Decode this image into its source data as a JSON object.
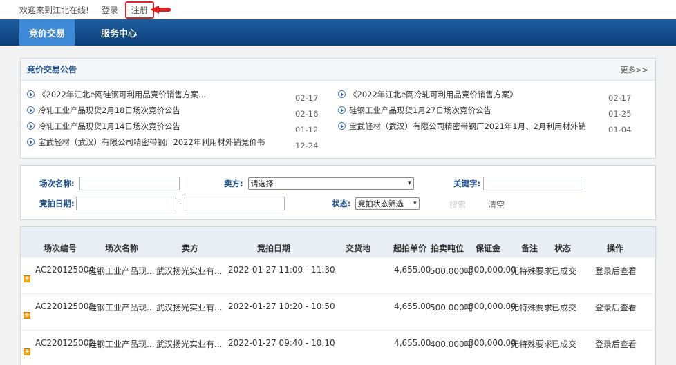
{
  "topbar": {
    "welcome": "欢迎来到江北在线!",
    "login": "登录",
    "register": "注册"
  },
  "nav": {
    "items": [
      {
        "label": "竞价交易",
        "active": true
      },
      {
        "label": "服务中心",
        "active": false
      }
    ]
  },
  "notice": {
    "title": "竞价交易公告",
    "more": "更多>>",
    "left": [
      {
        "title": "《2022年江北e网硅钢可利用品竞价销售方案...",
        "date": "02-17"
      },
      {
        "title": "冷轧工业产品现货2月18日场次竞价公告",
        "date": "02-16"
      },
      {
        "title": "冷轧工业产品现货1月14日场次竞价公告",
        "date": "01-12"
      },
      {
        "title": "宝武轻材（武汉）有限公司精密带钢厂2022年利用材外销竞价书",
        "date": "12-24"
      }
    ],
    "right": [
      {
        "title": "《2022年江北e网冷轧可利用品竞价销售方案》",
        "date": "02-17"
      },
      {
        "title": "硅钢工业产品现货1月27日场次竞价公告",
        "date": "01-25"
      },
      {
        "title": "宝武轻材（武汉）有限公司精密带钢厂2021年1月、2月利用材外销",
        "date": "01-04"
      }
    ]
  },
  "filter": {
    "session_name_label": "场次名称:",
    "seller_label": "卖方:",
    "seller_value": "请选择",
    "keyword_label": "关键字:",
    "date_label": "竞拍日期:",
    "date_separator": "-",
    "status_label": "状态:",
    "status_value": "竞拍状态筛选",
    "search": "搜索",
    "clear": "清空"
  },
  "table": {
    "headers": [
      "场次编号",
      "场次名称",
      "卖方",
      "竞拍日期",
      "交货地",
      "起拍单价",
      "拍卖吨位",
      "保证金",
      "备注",
      "状态",
      "操作"
    ],
    "rows": [
      {
        "id": "AC220125004",
        "name": "硅钢工业产品现...",
        "seller": "武汉扬光实业有...",
        "date": "2022-01-27 11:00 - 11:30",
        "place": "",
        "price": "4,655.00",
        "tonnage": "500.000吨",
        "deposit": "300,000.00",
        "remark": "无特殊要求",
        "status": "已成交",
        "action": "登录后查看"
      },
      {
        "id": "AC220125003",
        "name": "硅钢工业产品现...",
        "seller": "武汉扬光实业有...",
        "date": "2022-01-27 10:20 - 10:50",
        "place": "",
        "price": "4,655.00",
        "tonnage": "500.000吨",
        "deposit": "300,000.00",
        "remark": "无特殊要求",
        "status": "已成交",
        "action": "登录后查看"
      },
      {
        "id": "AC220125002",
        "name": "硅钢工业产品现...",
        "seller": "武汉扬光实业有...",
        "date": "2022-01-27 09:40 - 10:10",
        "place": "",
        "price": "4,655.00",
        "tonnage": "400.000吨",
        "deposit": "300,000.00",
        "remark": "无特殊要求",
        "status": "已成交",
        "action": "登录后查看"
      }
    ]
  },
  "colors": {
    "nav_bg": "#1d5d9e",
    "nav_active": "#3e8ad6",
    "label_blue": "#1d4f8c",
    "highlight_red": "#d9262b",
    "expander_orange": "#f0a21a"
  }
}
